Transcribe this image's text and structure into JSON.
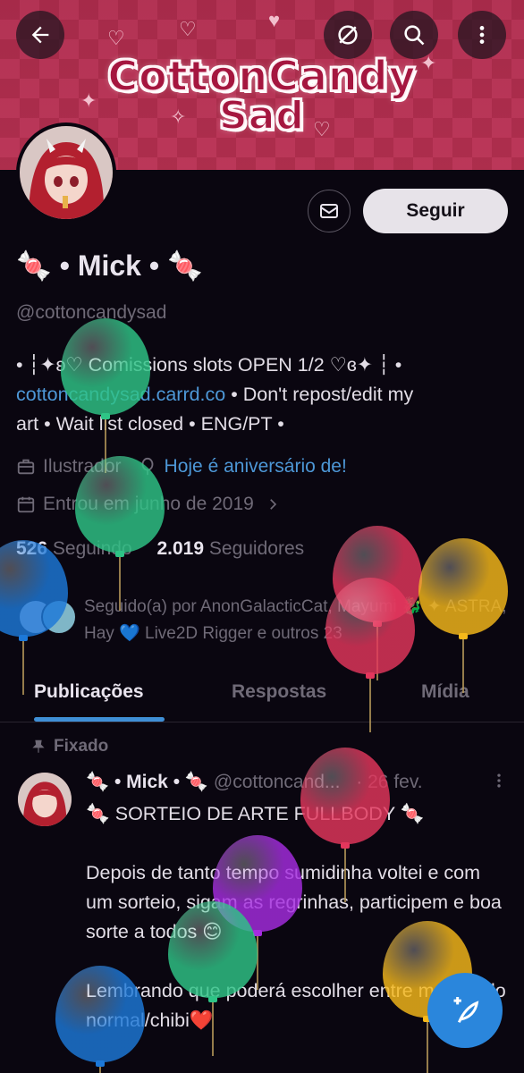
{
  "banner": {
    "title_line1": "CottonCandy",
    "title_line2": "Sad"
  },
  "topbar": {
    "back_icon": "arrow-left-icon",
    "mute_icon": "no-notifications-icon",
    "search_icon": "search-icon",
    "more_icon": "more-vertical-icon"
  },
  "profile": {
    "display_name": "🍬 • Mick • 🍬",
    "handle": "@cottoncandysad",
    "follow_label": "Seguir",
    "bio_line1": "• ┆✦ʚ♡  Comissions slots  OPEN 1/2 ♡ɞ✦ ┆ •",
    "bio_link": "cottoncandysad.carrd.co",
    "bio_line2_rest": " • Don't repost/edit my",
    "bio_line3": "art • Wait list closed • ENG/PT •",
    "profession": "Ilustrador",
    "birthday": "Hoje é aniversário de!",
    "joined": "Entrou em junho de 2019",
    "following_count": "526",
    "following_label": "Seguindo",
    "followers_count": "2.019",
    "followers_label": "Seguidores",
    "followed_by": "Seguido(a) por AnonGalacticCat, Mayumi 🐉 ✦ ASTRA, Hay 💙 Live2D Rigger e outros 23"
  },
  "tabs": [
    {
      "label": "Publicações",
      "active": true
    },
    {
      "label": "Respostas",
      "active": false
    },
    {
      "label": "Mídia",
      "active": false
    }
  ],
  "post": {
    "pinned_label": "Fixado",
    "author": "🍬 • Mick • 🍬",
    "handle": "@cottoncand...",
    "date": "· 26 fev.",
    "title": "🍬 SORTEIO DE ARTE FULLBODY 🍬",
    "para1": "Depois de tanto tempo sumidinha voltei e com um sorteio, sigam as regrinhas, participem e boa sorte a todos 😊",
    "para2": "Lembrando que poderá escolher entre meu estilo normal/chibi❤️"
  },
  "colors": {
    "accent": "#1d9bf0",
    "link": "#4d97d6",
    "banner": "#c23a5c",
    "background": "#0a0610"
  },
  "balloons": [
    {
      "color": "#2ec486"
    },
    {
      "color": "#2ec486"
    },
    {
      "color": "#1c78d8"
    },
    {
      "color": "#e3365c"
    },
    {
      "color": "#e3365c"
    },
    {
      "color": "#f5b81a"
    },
    {
      "color": "#e3365c"
    },
    {
      "color": "#a52ce0"
    },
    {
      "color": "#2ec486"
    },
    {
      "color": "#f5b81a"
    },
    {
      "color": "#1c78d8"
    }
  ]
}
